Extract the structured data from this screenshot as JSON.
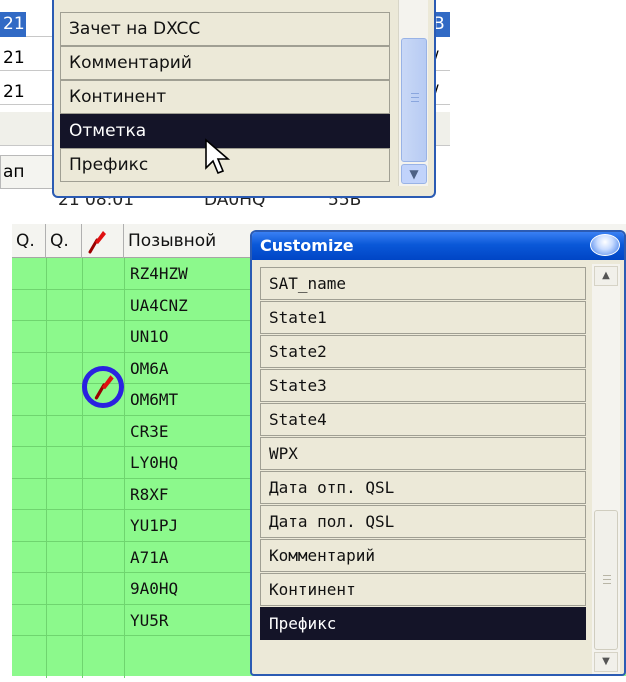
{
  "top_panel": {
    "bg_rows": [
      {
        "num": "21",
        "right": "B"
      },
      {
        "num": "21",
        "right": "/"
      },
      {
        "num": "21",
        "right": "/"
      }
    ],
    "partial_left_label": "ап",
    "bottom_row": {
      "time": "21 08:01",
      "call": "DA0HQ",
      "rst": "55B"
    },
    "dropdown_items": [
      "Зачет на DXCC",
      "Комментарий",
      "Континент",
      "Отметка",
      "Префикс"
    ],
    "selected_item": "Отметка"
  },
  "grid": {
    "headers": {
      "col1": "Q.",
      "col2": "Q.",
      "col4": "Позывной"
    },
    "callsigns": [
      "RZ4HZW",
      "UA4CNZ",
      "UN1O",
      "OM6A",
      "OM6MT",
      "CR3E",
      "LY0HQ",
      "R8XF",
      "YU1PJ",
      "A71A",
      "9A0HQ",
      "YU5R"
    ],
    "marked_callsign": "OM6A"
  },
  "customize": {
    "title": "Customize",
    "items": [
      "SAT_name",
      "State1",
      "State2",
      "State3",
      "State4",
      "WPX",
      "Дата отп. QSL",
      "Дата пол. QSL",
      "Комментарий",
      "Континент",
      "Префикс"
    ],
    "selected_item": "Префикс"
  },
  "colors": {
    "grid_bg": "#8cf98c",
    "selection": "#141428",
    "titlebar": "#0a58d8",
    "highlight_circle": "#2a22e0",
    "pin": "#e01010"
  },
  "icons": {
    "pin": "pin-icon",
    "cursor": "mouse-cursor-icon"
  }
}
